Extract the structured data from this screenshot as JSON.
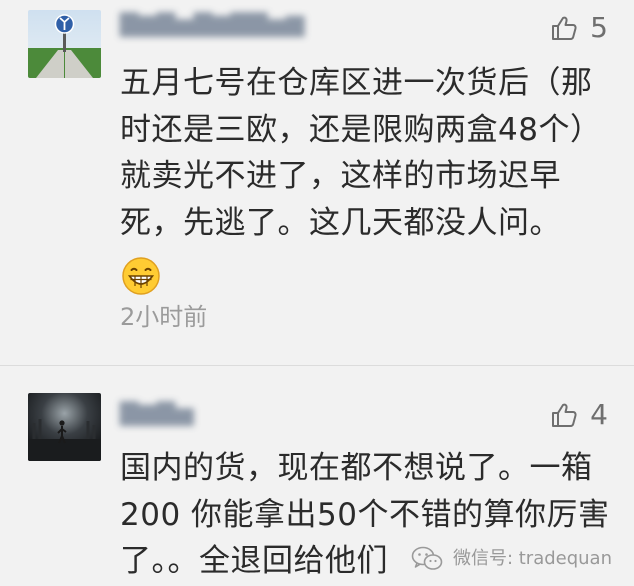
{
  "comments": [
    {
      "avatar_icon": "road-sign-avatar",
      "likes": "5",
      "text": "五月七号在仓库区进一次货后（那时还是三欧，还是限购两盒48个）就卖光不进了，这样的市场迟早死，先逃了。这几天都没人问。",
      "emoji": "grinning-face-emoji",
      "time": "2小时前"
    },
    {
      "avatar_icon": "night-scene-avatar",
      "likes": "4",
      "text": "国内的货，现在都不想说了。一箱200 你能拿出50个不错的算你厉害了。。全退回给他们"
    }
  ],
  "watermark": {
    "icon": "wechat-icon",
    "label": "微信号: tradequan"
  },
  "colors": {
    "background": "#f2f2f2",
    "text": "#2b2b2b",
    "meta": "#9b9b9b",
    "like": "#6f6f6f"
  }
}
